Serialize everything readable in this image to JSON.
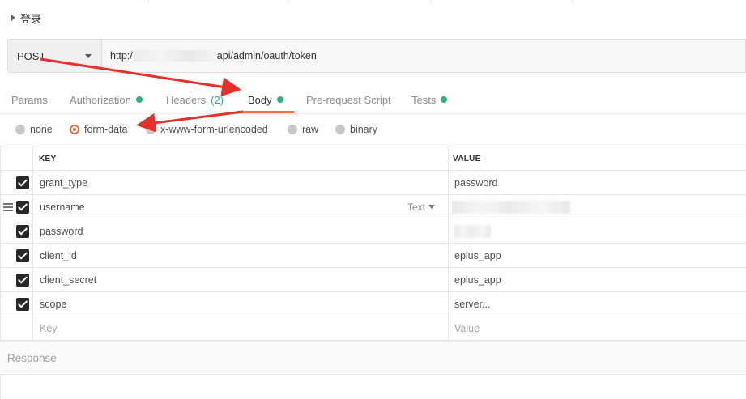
{
  "request": {
    "name": "登录"
  },
  "urlbar": {
    "method": "POST",
    "url_prefix": "http:/",
    "url_suffix": "api/admin/oauth/token"
  },
  "tabs": [
    {
      "label": "Params"
    },
    {
      "label": "Authorization",
      "dot": true
    },
    {
      "label": "Headers",
      "count": "(2)"
    },
    {
      "label": "Body",
      "dot": true,
      "active": true
    },
    {
      "label": "Pre-request Script"
    },
    {
      "label": "Tests",
      "dot": true
    }
  ],
  "body_types": [
    {
      "label": "none"
    },
    {
      "label": "form-data",
      "selected": true
    },
    {
      "label": "x-www-form-urlencoded"
    },
    {
      "label": "raw"
    },
    {
      "label": "binary"
    }
  ],
  "table": {
    "key_header": "KEY",
    "value_header": "VALUE",
    "type_selector": "Text",
    "rows": [
      {
        "key": "grant_type",
        "value": "password",
        "checked": true
      },
      {
        "key": "username",
        "value": "",
        "checked": true
      },
      {
        "key": "password",
        "value": "",
        "checked": true
      },
      {
        "key": "client_id",
        "value": "eplus_app",
        "checked": true
      },
      {
        "key": "client_secret",
        "value": "eplus_app",
        "checked": true
      },
      {
        "key": "scope",
        "value": "server...",
        "checked": true
      }
    ],
    "key_placeholder": "Key",
    "value_placeholder": "Value"
  },
  "response": {
    "label": "Response"
  },
  "colors": {
    "accent": "#f26b3a",
    "status_dot": "#26b47f",
    "arrow": "#e8302a"
  }
}
